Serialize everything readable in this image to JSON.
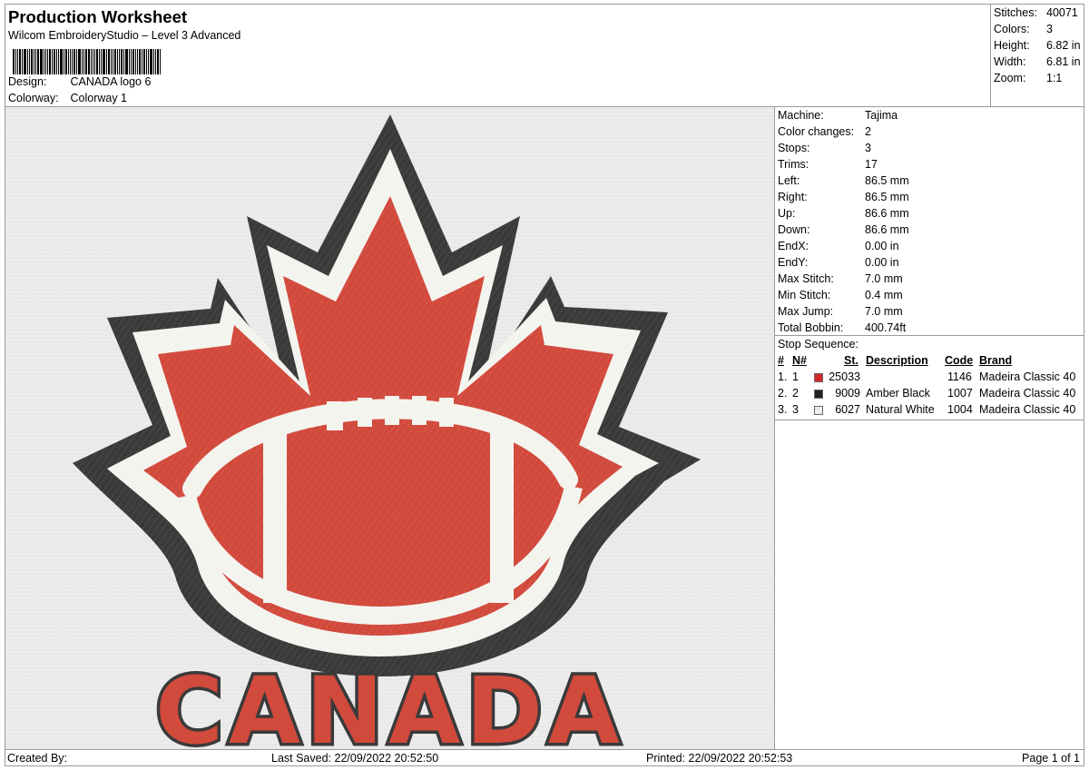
{
  "header": {
    "title": "Production Worksheet",
    "software": "Wilcom EmbroideryStudio – Level 3 Advanced",
    "design_label": "Design:",
    "design_value": "CANADA logo 6",
    "colorway_label": "Colorway:",
    "colorway_value": "Colorway 1"
  },
  "summary": [
    {
      "label": "Stitches:",
      "value": "40071"
    },
    {
      "label": "Colors:",
      "value": "3"
    },
    {
      "label": "Height:",
      "value": "6.82 in"
    },
    {
      "label": "Width:",
      "value": "6.81 in"
    },
    {
      "label": "Zoom:",
      "value": "1:1"
    }
  ],
  "details": [
    {
      "label": "Machine:",
      "value": "Tajima"
    },
    {
      "label": "Color changes:",
      "value": "2"
    },
    {
      "label": "Stops:",
      "value": "3"
    },
    {
      "label": "Trims:",
      "value": "17"
    },
    {
      "label": "Left:",
      "value": "86.5 mm"
    },
    {
      "label": "Right:",
      "value": "86.5 mm"
    },
    {
      "label": "Up:",
      "value": "86.6 mm"
    },
    {
      "label": "Down:",
      "value": "86.6 mm"
    },
    {
      "label": "EndX:",
      "value": "0.00 in"
    },
    {
      "label": "EndY:",
      "value": "0.00 in"
    },
    {
      "label": "Max Stitch:",
      "value": "7.0 mm"
    },
    {
      "label": "Min Stitch:",
      "value": "0.4 mm"
    },
    {
      "label": "Max Jump:",
      "value": "7.0 mm"
    },
    {
      "label": "Total Bobbin:",
      "value": "400.74ft"
    }
  ],
  "stop_sequence": {
    "title": "Stop Sequence:",
    "columns": {
      "idx": "#",
      "n": "N#",
      "st": "St.",
      "description": "Description",
      "code": "Code",
      "brand": "Brand"
    },
    "rows": [
      {
        "idx": "1.",
        "n": "1",
        "color": "#d42a2a",
        "st": "25033",
        "description": "",
        "code": "1146",
        "brand": "Madeira Classic 40"
      },
      {
        "idx": "2.",
        "n": "2",
        "color": "#222222",
        "st": "9009",
        "description": "Amber Black",
        "code": "1007",
        "brand": "Madeira Classic 40"
      },
      {
        "idx": "3.",
        "n": "3",
        "color": "#ececf0",
        "st": "6027",
        "description": "Natural White",
        "code": "1004",
        "brand": "Madeira Classic 40"
      }
    ]
  },
  "design": {
    "wordmark": "CANADA",
    "colors": {
      "red": "#d24a3c",
      "black": "#3a3a3a",
      "white": "#f4f4ef",
      "background": "#ececec"
    }
  },
  "footer": {
    "created_by": "Created By:",
    "last_saved": "Last Saved: 22/09/2022 20:52:50",
    "printed": "Printed: 22/09/2022 20:52:53",
    "page": "Page 1 of 1"
  }
}
